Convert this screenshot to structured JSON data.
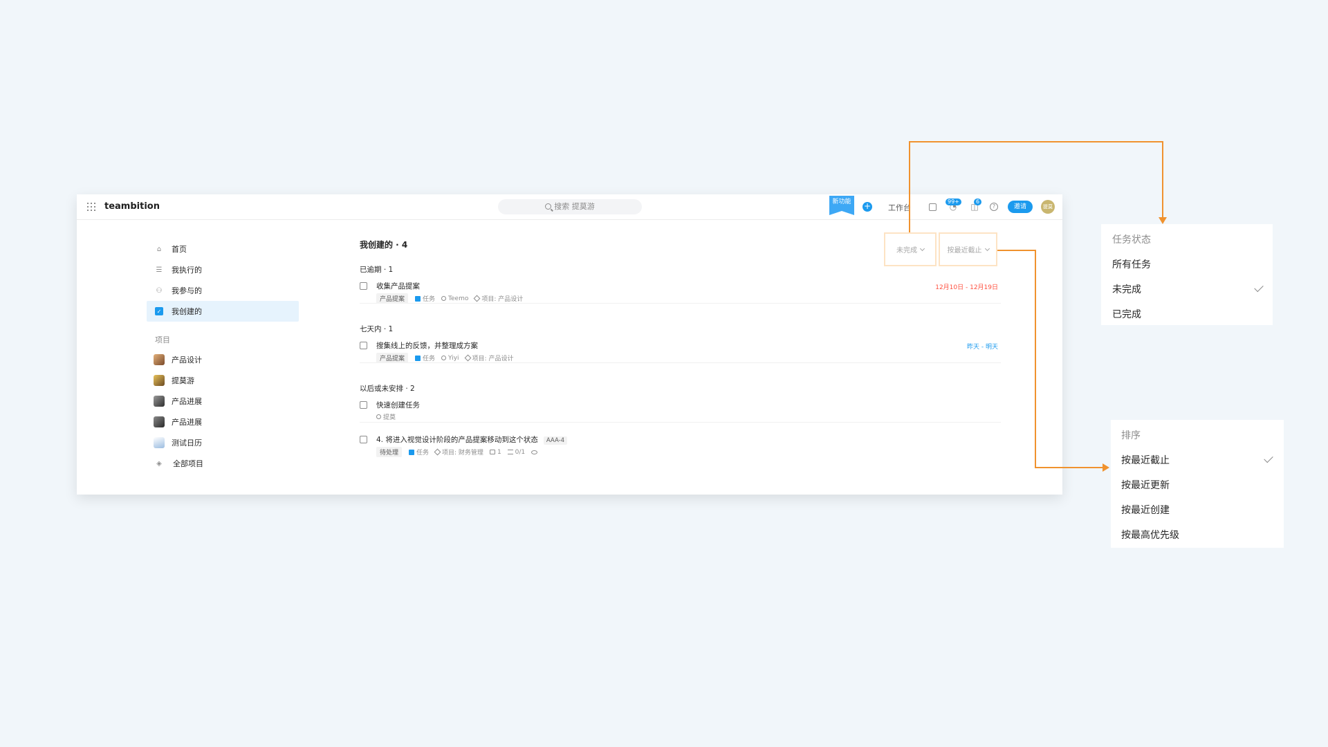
{
  "topbar": {
    "logo": "teambition",
    "search_placeholder": "搜索 提莫游",
    "new_feature": "新功能",
    "plus": "+",
    "workbench": "工作台",
    "notifications_badge": "99+",
    "messages_badge": "6",
    "invite": "邀请",
    "avatar_text": "提莫"
  },
  "sidebar": {
    "nav": [
      {
        "label": "首页",
        "icon": "home-icon"
      },
      {
        "label": "我执行的",
        "icon": "list-icon"
      },
      {
        "label": "我参与的",
        "icon": "people-icon"
      },
      {
        "label": "我创建的",
        "icon": "clipboard-icon"
      }
    ],
    "projects_label": "项目",
    "projects": [
      {
        "label": "产品设计",
        "color": "#b06a3a"
      },
      {
        "label": "提莫游",
        "color": "#c49a3a"
      },
      {
        "label": "产品进展",
        "color": "#4a4a4a"
      },
      {
        "label": "产品进展",
        "color": "#4a4a4a"
      },
      {
        "label": "测试日历",
        "color": "#9bbde0"
      },
      {
        "label": "全部项目",
        "icon": "layers-icon"
      }
    ]
  },
  "content": {
    "title": "我创建的 · 4",
    "filter_status": "未完成",
    "filter_sort": "按最近截止",
    "groups": [
      {
        "title": "已逾期 · 1",
        "tasks": [
          {
            "title": "收集产品提案",
            "tag": "产品提案",
            "type": "任务",
            "assignee": "Teemo",
            "project": "项目: 产品设计",
            "date": "12月10日 - 12月19日"
          }
        ]
      },
      {
        "title": "七天内 · 1",
        "tasks": [
          {
            "title": "搜集线上的反馈，并整理成方案",
            "tag": "产品提案",
            "type": "任务",
            "assignee": "Yiyi",
            "project": "项目: 产品设计",
            "date": "昨天 - 明天"
          }
        ]
      },
      {
        "title": "以后或未安排 · 2",
        "tasks": [
          {
            "title": "快速创建任务",
            "assignee": "提莫"
          },
          {
            "title": "4. 将进入视觉设计阶段的产品提案移动到这个状态",
            "code": "AAA-4",
            "tag": "待处理",
            "type": "任务",
            "project": "项目: 财务管理",
            "comments": "1",
            "subtasks": "0/1"
          }
        ]
      }
    ]
  },
  "status_panel": {
    "title": "任务状态",
    "items": [
      "所有任务",
      "未完成",
      "已完成"
    ],
    "selected": "未完成"
  },
  "sort_panel": {
    "title": "排序",
    "items": [
      "按最近截止",
      "按最近更新",
      "按最近创建",
      "按最高优先级"
    ],
    "selected": "按最近截止"
  },
  "colors": {
    "accent": "#1b9aee",
    "overdue": "#ff4f3e",
    "annotation": "#f0922e",
    "highlight": "#fde3c4"
  }
}
